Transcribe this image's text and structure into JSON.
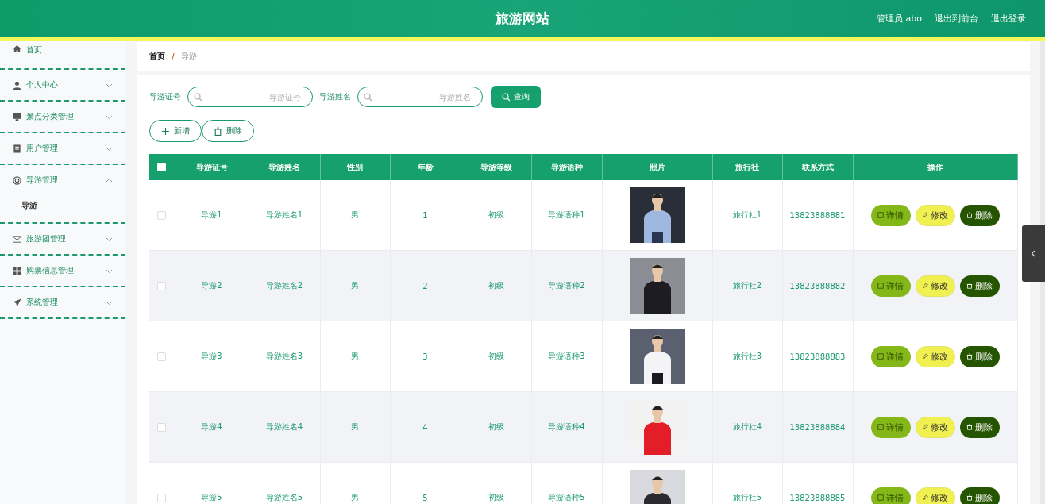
{
  "header": {
    "title": "旅游网站",
    "links": [
      {
        "label": "管理员 abo"
      },
      {
        "label": "退出到前台"
      },
      {
        "label": "退出登录"
      }
    ]
  },
  "sidebar": {
    "items": [
      {
        "label": "首页"
      },
      {
        "label": "个人中心",
        "expanded": false
      },
      {
        "label": "景点分类管理",
        "expanded": false
      },
      {
        "label": "用户管理",
        "expanded": false
      },
      {
        "label": "导游管理",
        "expanded": true,
        "children": [
          {
            "label": "导游",
            "selected": true
          }
        ]
      },
      {
        "label": "旅游团管理",
        "expanded": false
      },
      {
        "label": "购票信息管理",
        "expanded": false
      },
      {
        "label": "系统管理",
        "expanded": false
      }
    ]
  },
  "breadcrumb": {
    "separator": "/",
    "items": [
      {
        "label": "首页"
      },
      {
        "label": "导游"
      }
    ]
  },
  "search": {
    "fields": [
      {
        "label": "导游证号",
        "placeholder": "导游证号"
      },
      {
        "label": "导游姓名",
        "placeholder": "导游姓名"
      }
    ],
    "button": "查询"
  },
  "actions": [
    {
      "kind": "add",
      "label": "新增"
    },
    {
      "kind": "delete",
      "label": "删除"
    }
  ],
  "table": {
    "header_checked": false,
    "columns": [
      "导游证号",
      "导游姓名",
      "性别",
      "年龄",
      "导游等级",
      "导游语种",
      "照片",
      "旅行社",
      "联系方式",
      "操作"
    ],
    "rows": [
      {
        "checked": false,
        "cells": [
          "导游1",
          "导游姓名1",
          "男",
          "1",
          "初级",
          "导游语种1"
        ],
        "agency": "旅行社1",
        "phone": "13823888881",
        "buttons": [
          {
            "kind": "detail",
            "label": "详情"
          },
          {
            "kind": "edit",
            "label": "修改"
          },
          {
            "kind": "delete",
            "label": "删除"
          }
        ]
      },
      {
        "checked": false,
        "cells": [
          "导游2",
          "导游姓名2",
          "男",
          "2",
          "初级",
          "导游语种2"
        ],
        "agency": "旅行社2",
        "phone": "13823888882",
        "buttons": [
          {
            "kind": "detail",
            "label": "详情"
          },
          {
            "kind": "edit",
            "label": "修改"
          },
          {
            "kind": "delete",
            "label": "删除"
          }
        ]
      },
      {
        "checked": false,
        "cells": [
          "导游3",
          "导游姓名3",
          "男",
          "3",
          "初级",
          "导游语种3"
        ],
        "agency": "旅行社3",
        "phone": "13823888883",
        "buttons": [
          {
            "kind": "detail",
            "label": "详情"
          },
          {
            "kind": "edit",
            "label": "修改"
          },
          {
            "kind": "delete",
            "label": "删除"
          }
        ]
      },
      {
        "checked": false,
        "cells": [
          "导游4",
          "导游姓名4",
          "男",
          "4",
          "初级",
          "导游语种4"
        ],
        "agency": "旅行社4",
        "phone": "13823888884",
        "buttons": [
          {
            "kind": "detail",
            "label": "详情"
          },
          {
            "kind": "edit",
            "label": "修改"
          },
          {
            "kind": "delete",
            "label": "删除"
          }
        ]
      },
      {
        "checked": false,
        "cells": [
          "导游5",
          "导游姓名5",
          "男",
          "5",
          "初级",
          "导游语种5"
        ],
        "agency": "旅行社5",
        "phone": "13823888885",
        "buttons": [
          {
            "kind": "detail",
            "label": "详情"
          },
          {
            "kind": "edit",
            "label": "修改"
          },
          {
            "kind": "delete",
            "label": "删除"
          }
        ]
      }
    ]
  }
}
